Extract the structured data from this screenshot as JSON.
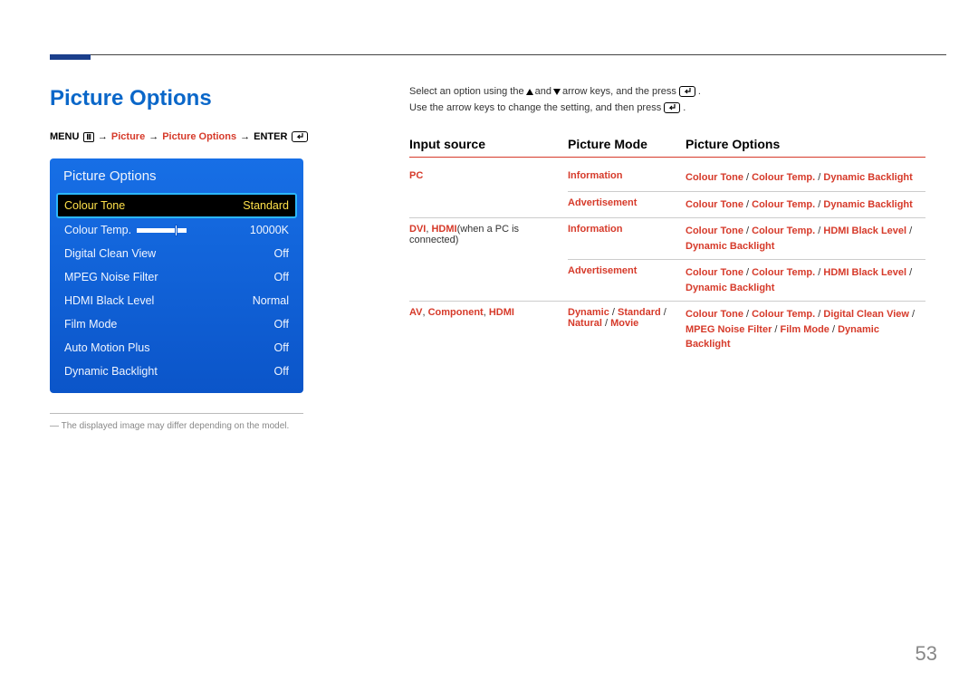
{
  "page_number": "53",
  "page_title": "Picture Options",
  "breadcrumb": {
    "menu": "MENU",
    "lvl1": "Picture",
    "lvl2": "Picture Options",
    "enter": "ENTER"
  },
  "osd": {
    "title": "Picture Options",
    "rows": [
      {
        "label": "Colour Tone",
        "value": "Standard",
        "selected": true
      },
      {
        "label": "Colour Temp.",
        "value": "10000K",
        "slider": true
      },
      {
        "label": "Digital Clean View",
        "value": "Off"
      },
      {
        "label": "MPEG Noise Filter",
        "value": "Off"
      },
      {
        "label": "HDMI Black Level",
        "value": "Normal"
      },
      {
        "label": "Film Mode",
        "value": "Off"
      },
      {
        "label": "Auto Motion Plus",
        "value": "Off"
      },
      {
        "label": "Dynamic Backlight",
        "value": "Off"
      }
    ]
  },
  "note": "The displayed image may differ depending on the model.",
  "instructions": {
    "line1a": "Select an option using the ",
    "line1b": " and ",
    "line1c": " arrow keys, and the press ",
    "line1d": ".",
    "line2a": "Use the arrow keys to change the setting, and then press ",
    "line2b": "."
  },
  "table": {
    "headers": {
      "c1": "Input source",
      "c2": "Picture Mode",
      "c3": "Picture Options"
    },
    "groups": [
      {
        "source_html": "<span class='red'>PC</span>",
        "subs": [
          {
            "mode": "Information",
            "opts": "<span class='red'>Colour Tone</span> / <span class='red'>Colour Temp.</span> / <span class='red'>Dynamic Backlight</span>"
          },
          {
            "mode": "Advertisement",
            "opts": "<span class='red'>Colour Tone</span> / <span class='red'>Colour Temp.</span> / <span class='red'>Dynamic Backlight</span>"
          }
        ]
      },
      {
        "source_html": "<span class='red'>DVI</span><span class='plain'>, </span><span class='red'>HDMI</span><span class='plain'>(when a PC is connected)</span>",
        "subs": [
          {
            "mode": "Information",
            "opts": "<span class='red'>Colour Tone</span> / <span class='red'>Colour Temp.</span> / <span class='red'>HDMI Black Level</span> / <span class='red'>Dynamic Backlight</span>"
          },
          {
            "mode": "Advertisement",
            "opts": "<span class='red'>Colour Tone</span> / <span class='red'>Colour Temp.</span> / <span class='red'>HDMI Black Level</span> / <span class='red'>Dynamic Backlight</span>"
          }
        ]
      },
      {
        "source_html": "<span class='red'>AV</span><span class='plain'>, </span><span class='red'>Component</span><span class='plain'>, </span><span class='red'>HDMI</span>",
        "subs": [
          {
            "mode": "Dynamic <span class='plain'>/</span> Standard <span class='plain'>/</span> Natural <span class='plain'>/</span> Movie",
            "opts": "<span class='red'>Colour Tone</span> / <span class='red'>Colour Temp.</span> / <span class='red'>Digital Clean View</span> / <span class='red'>MPEG Noise Filter</span> / <span class='red'>Film Mode</span> / <span class='red'>Dynamic Backlight</span>"
          }
        ]
      }
    ]
  }
}
